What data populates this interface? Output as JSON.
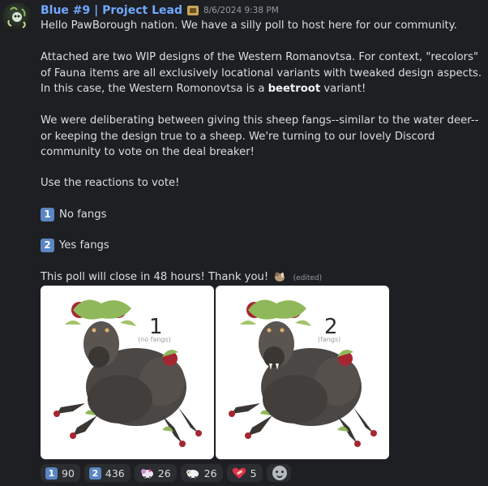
{
  "message": {
    "author": "Blue #9 | Project Lead",
    "timestamp": "8/6/2024 9:38 PM",
    "line1": "Hello PawBorough nation. We have a silly poll to host here for our community.",
    "para2_a": "Attached are two WIP designs of the Western Romanovtsa. For context, \"recolors\" of Fauna items are all exclusively locational variants with tweaked design aspects. In this case, the Western Romonovtsa is a ",
    "para2_bold": "beetroot",
    "para2_b": " variant!",
    "para3": "We were deliberating between giving this sheep fangs--similar to the water deer--or keeping the design true to a sheep. We're turning to our lovely Discord community to vote on the deal breaker!",
    "para4": "Use the reactions to vote!",
    "option1_key": "1",
    "option1_label": "No fangs",
    "option2_key": "2",
    "option2_label": "Yes fangs",
    "closing": "This poll will close in 48 hours! Thank you!",
    "edited": "(edited)"
  },
  "attachments": [
    {
      "number": "1",
      "caption": "(no fangs)"
    },
    {
      "number": "2",
      "caption": "(fangs)"
    }
  ],
  "reactions": [
    {
      "emoji": "keycap-1",
      "label": "1",
      "count": "90"
    },
    {
      "emoji": "keycap-2",
      "label": "2",
      "count": "436"
    },
    {
      "emoji": "sheep-sticker",
      "count": "26"
    },
    {
      "emoji": "sheep-emoji",
      "count": "26"
    },
    {
      "emoji": "heart-emoji",
      "count": "5"
    }
  ],
  "colors": {
    "background": "#1e1f22",
    "username": "#6fa8ff",
    "keycap": "#5a86c4",
    "reaction_bg": "#2b2d31"
  }
}
